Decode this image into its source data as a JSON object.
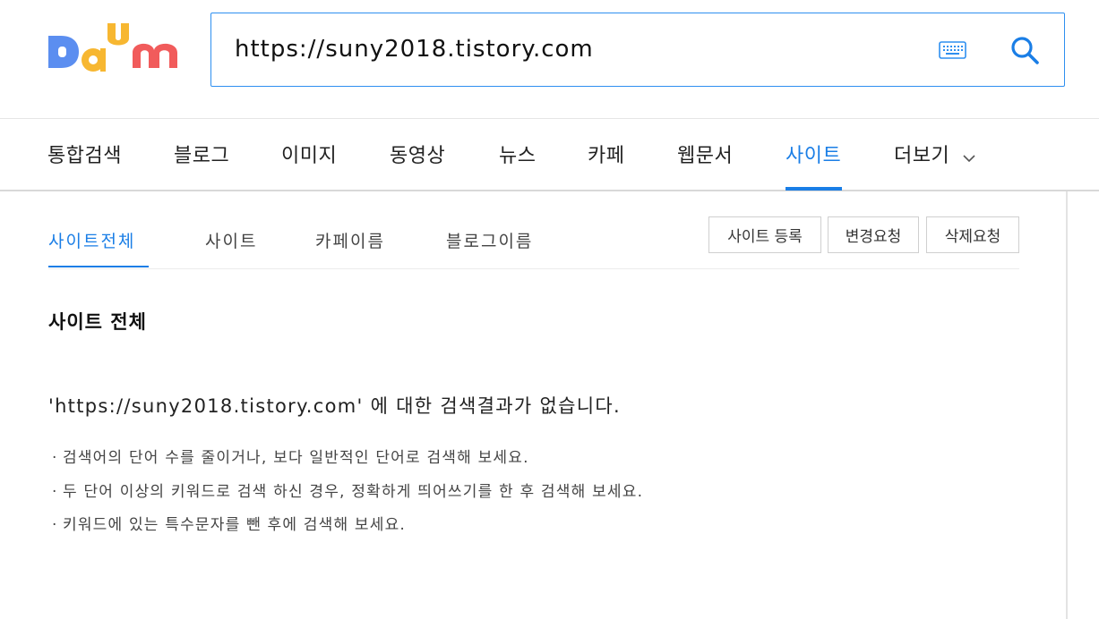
{
  "header": {
    "search_value": "https://suny2018.tistory.com",
    "colors": {
      "accent": "#1a7ee6",
      "border": "#2e8ff0"
    }
  },
  "main_tabs": [
    {
      "label": "통합검색"
    },
    {
      "label": "블로그"
    },
    {
      "label": "이미지"
    },
    {
      "label": "동영상"
    },
    {
      "label": "뉴스"
    },
    {
      "label": "카페"
    },
    {
      "label": "웹문서"
    },
    {
      "label": "사이트",
      "active": true
    },
    {
      "label": "더보기"
    }
  ],
  "sub_tabs": [
    {
      "label": "사이트전체",
      "active": true
    },
    {
      "label": "사이트"
    },
    {
      "label": "카페이름"
    },
    {
      "label": "블로그이름"
    }
  ],
  "actions": {
    "register": "사이트 등록",
    "change": "변경요청",
    "delete": "삭제요청"
  },
  "results": {
    "section_title": "사이트 전체",
    "no_result": "'https://suny2018.tistory.com' 에 대한 검색결과가 없습니다.",
    "tips": [
      "검색어의 단어 수를 줄이거나, 보다 일반적인 단어로 검색해 보세요.",
      "두 단어 이상의 키워드로 검색 하신 경우, 정확하게 띄어쓰기를 한 후 검색해 보세요.",
      "키워드에 있는 특수문자를 뺀 후에 검색해 보세요."
    ]
  }
}
